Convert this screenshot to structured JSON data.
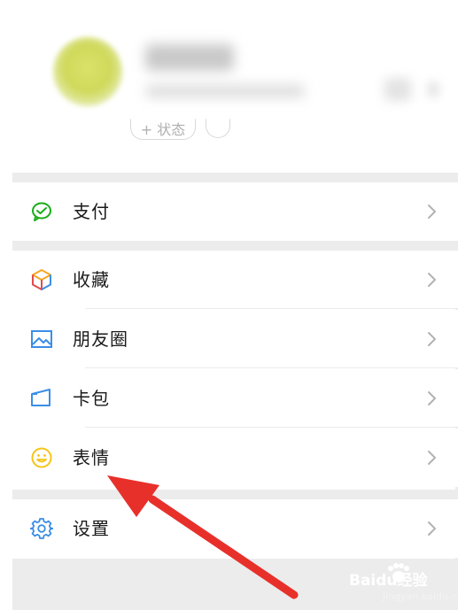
{
  "profile": {
    "status_button_label": "+ 状态"
  },
  "menu": {
    "pay": {
      "label": "支付",
      "icon": "wechat-pay-icon",
      "color": "#1aad19"
    },
    "favorites": {
      "label": "收藏",
      "icon": "favorites-cube-icon",
      "color": "#f5a623"
    },
    "moments": {
      "label": "朋友圈",
      "icon": "picture-icon",
      "color": "#3a8ee6"
    },
    "cards": {
      "label": "卡包",
      "icon": "card-wallet-icon",
      "color": "#3a8ee6"
    },
    "stickers": {
      "label": "表情",
      "icon": "smiley-icon",
      "color": "#f5c518"
    },
    "settings": {
      "label": "设置",
      "icon": "gear-icon",
      "color": "#3a8ee6"
    }
  },
  "annotation": {
    "color": "#e8302b",
    "points_to": "表情"
  },
  "watermark": {
    "brand": "Baidu经验",
    "sub": "jingyan.baidu.com"
  },
  "colors": {
    "background": "#ffffff",
    "separator": "#ececec",
    "chevron": "#b2b2b2"
  }
}
